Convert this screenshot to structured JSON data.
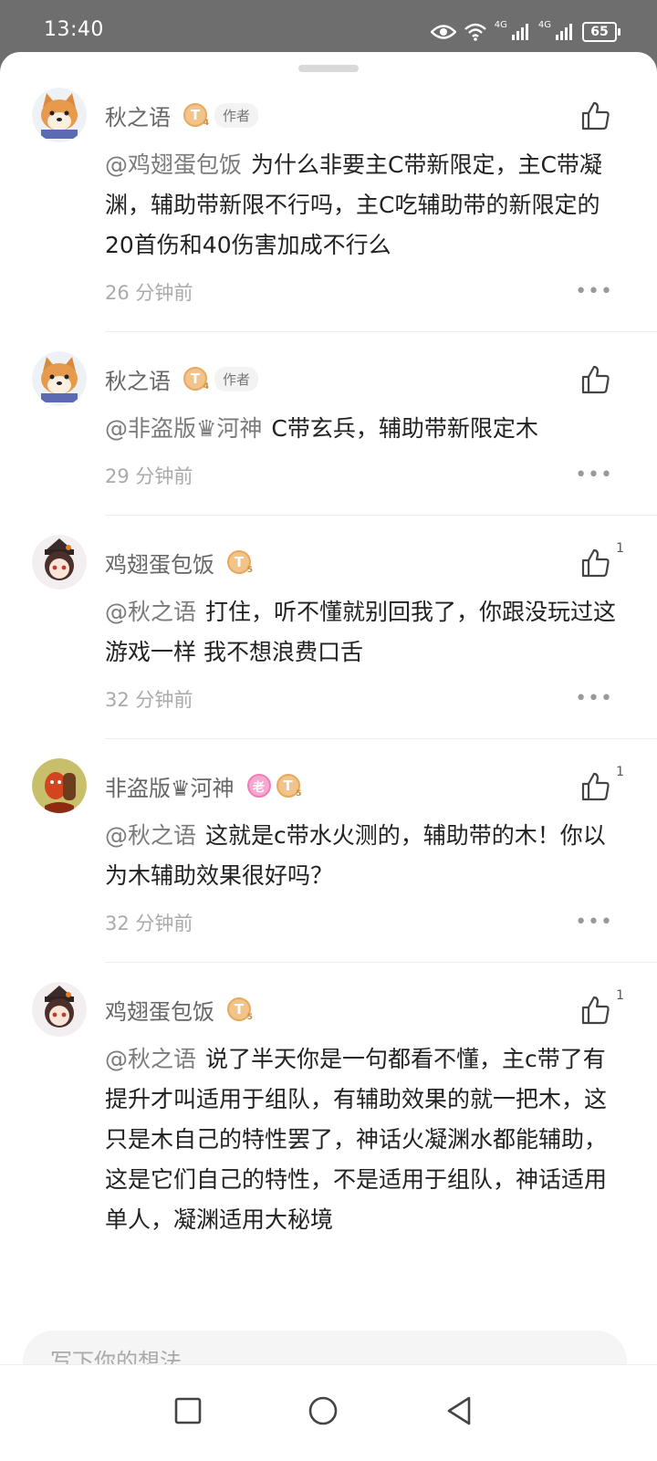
{
  "status": {
    "time": "13:40",
    "network1": "4G",
    "network2": "4G",
    "battery": "65"
  },
  "comments": [
    {
      "name": "秋之语",
      "badge": "T",
      "badge_level": "4",
      "author_tag": "作者",
      "mention": "@鸡翅蛋包饭",
      "text": "为什么非要主C带新限定，主C带凝渊，辅助带新限不行吗，主C吃辅助带的新限定的20首伤和40伤害加成不行么",
      "time": "26 分钟前",
      "likes": "",
      "avatar_icon": "shiba-dog-avatar"
    },
    {
      "name": "秋之语",
      "badge": "T",
      "badge_level": "4",
      "author_tag": "作者",
      "mention": "@非盗版♛河神",
      "text": "C带玄兵，辅助带新限定木",
      "time": "29 分钟前",
      "likes": "",
      "avatar_icon": "shiba-dog-avatar"
    },
    {
      "name": "鸡翅蛋包饭",
      "badge": "T",
      "badge_level": "5",
      "author_tag": "",
      "mention": "@秋之语",
      "text": "打住，听不懂就别回我了，你跟没玩过这游戏一样 我不想浪费口舌",
      "time": "32 分钟前",
      "likes": "1",
      "avatar_icon": "anime-girl-avatar"
    },
    {
      "name": "非盗版♛河神",
      "badge": "T",
      "badge_level": "5",
      "pink_badge": "老",
      "author_tag": "",
      "mention": "@秋之语",
      "text": "这就是c带水火测的，辅助带的木！你以为木辅助效果很好吗？",
      "time": "32 分钟前",
      "likes": "1",
      "avatar_icon": "cartoon-character-avatar"
    },
    {
      "name": "鸡翅蛋包饭",
      "badge": "T",
      "badge_level": "5",
      "author_tag": "",
      "mention": "@秋之语",
      "text": "说了半天你是一句都看不懂，主c带了有提升才叫适用于组队，有辅助效果的就一把木，这只是木自己的特性罢了，神话火凝渊水都能辅助，这是它们自己的特性，不是适用于组队，神话适用单人，凝渊适用大秘境",
      "time": "",
      "likes": "1",
      "avatar_icon": "anime-girl-avatar"
    }
  ],
  "input": {
    "placeholder": "写下你的想法..."
  },
  "nav": {
    "recent_icon": "square-icon",
    "home_icon": "circle-icon",
    "back_icon": "triangle-back-icon"
  }
}
